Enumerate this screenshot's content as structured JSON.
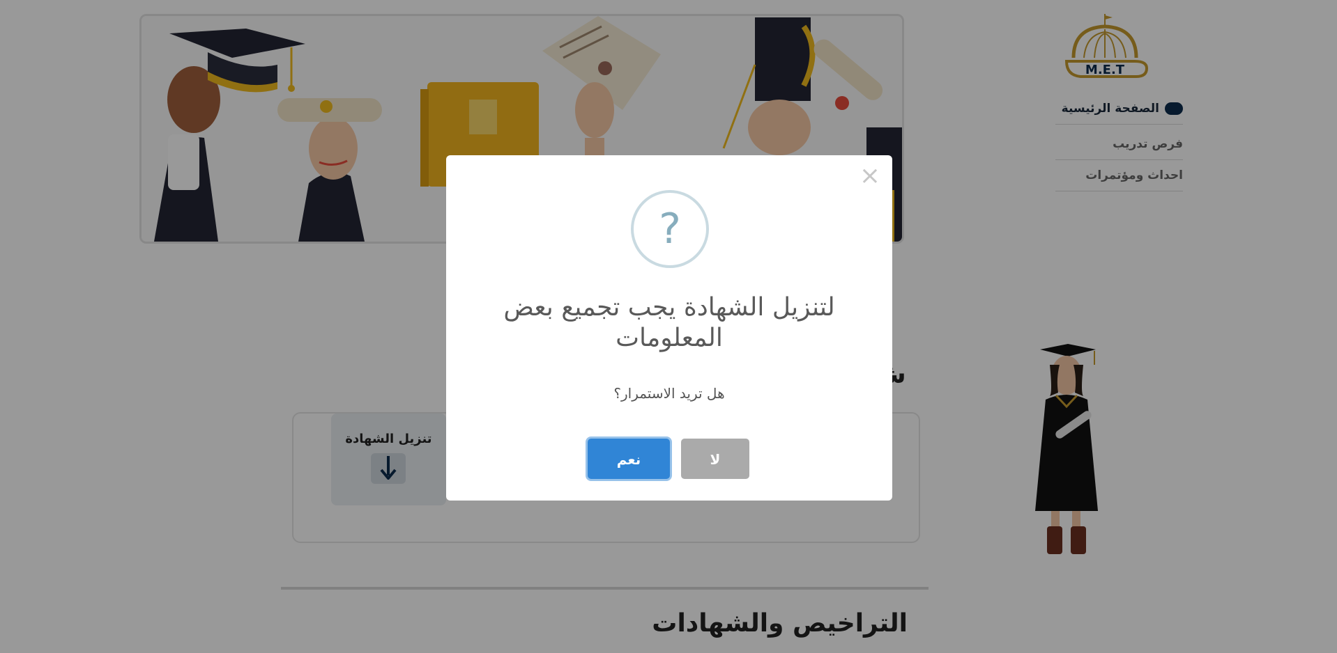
{
  "logo": {
    "text": "M.E.T",
    "color": "#c59a2e"
  },
  "nav": {
    "items": [
      {
        "label": "الصفحة الرئيسية",
        "active": true
      },
      {
        "label": "فرص تدريب",
        "active": false
      },
      {
        "label": "احداث ومؤتمرات",
        "active": false
      }
    ]
  },
  "section": {
    "title_cut": "ش"
  },
  "certificate": {
    "download_label": "تنزيل الشهادة"
  },
  "licenses": {
    "title": "التراخيص والشهادات"
  },
  "modal": {
    "icon": "?",
    "title": "لتنزيل الشهادة يجب تجميع بعض المعلومات",
    "text": "هل تريد الاستمرار؟",
    "confirm_label": "نعم",
    "cancel_label": "لا",
    "close_symbol": "×",
    "colors": {
      "confirm": "#3085d6",
      "cancel": "#aaaaaa",
      "icon": "#87adbd"
    }
  }
}
